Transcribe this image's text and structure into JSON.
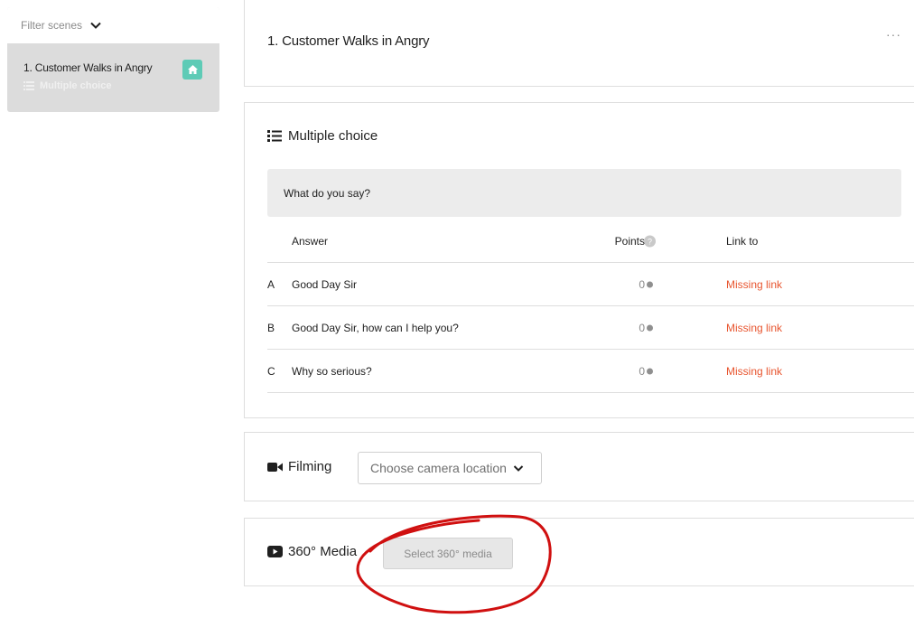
{
  "sidebar": {
    "filter_label": "Filter scenes",
    "scene_title": "1. Customer Walks in Angry",
    "scene_subtitle": "Multiple choice"
  },
  "scene": {
    "title": "1. Customer Walks in Angry",
    "more_label": "···"
  },
  "multiple_choice": {
    "header": "Multiple choice",
    "question": "What do you say?",
    "columns": {
      "answer": "Answer",
      "points": "Points",
      "link_to": "Link to"
    },
    "answers": [
      {
        "letter": "A",
        "text": "Good Day Sir",
        "points": "0",
        "link": "Missing link"
      },
      {
        "letter": "B",
        "text": "Good Day Sir, how can I help you?",
        "points": "0",
        "link": "Missing link"
      },
      {
        "letter": "C",
        "text": "Why so serious?",
        "points": "0",
        "link": "Missing link"
      }
    ]
  },
  "filming": {
    "label": "Filming",
    "select_label": "Choose camera location"
  },
  "media": {
    "label": "360° Media",
    "button_label": "Select 360° media"
  },
  "colors": {
    "accent_teal": "#5ecbb6",
    "missing_link": "#e8552f",
    "annotation_red": "#d01010"
  },
  "icons": [
    "chevron-down-icon",
    "home-icon",
    "list-icon",
    "camera-icon",
    "youtube-icon",
    "help-icon",
    "more-icon"
  ]
}
